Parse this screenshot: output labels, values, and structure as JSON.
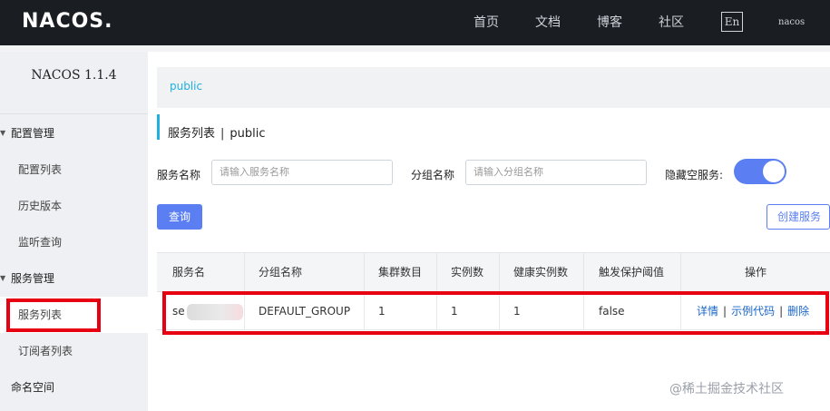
{
  "header": {
    "logo": "NACOS.",
    "nav": [
      "首页",
      "文档",
      "博客",
      "社区"
    ],
    "lang": "En",
    "user": "nacos"
  },
  "sidebar": {
    "version": "NACOS 1.1.4",
    "items": [
      {
        "label": "配置管理",
        "type": "group"
      },
      {
        "label": "配置列表",
        "type": "sub"
      },
      {
        "label": "历史版本",
        "type": "sub"
      },
      {
        "label": "监听查询",
        "type": "sub"
      },
      {
        "label": "服务管理",
        "type": "group"
      },
      {
        "label": "服务列表",
        "type": "sub"
      },
      {
        "label": "订阅者列表",
        "type": "sub"
      },
      {
        "label": "命名空间",
        "type": "group"
      }
    ]
  },
  "main": {
    "namespace": "public",
    "title": "服务列表",
    "title_sep": "|",
    "title_ns": "public",
    "filters": {
      "service_label": "服务名称",
      "service_placeholder": "请输入服务名称",
      "group_label": "分组名称",
      "group_placeholder": "请输入分组名称",
      "hide_empty_label": "隐藏空服务:"
    },
    "query_button": "查询",
    "create_button": "创建服务",
    "table": {
      "columns": [
        "服务名",
        "分组名称",
        "集群数目",
        "实例数",
        "健康实例数",
        "触发保护阈值",
        "操作"
      ],
      "rows": [
        {
          "service": "se",
          "group": "DEFAULT_GROUP",
          "clusters": "1",
          "instances": "1",
          "healthy": "1",
          "threshold": "false",
          "ops": [
            "详情",
            "示例代码",
            "删除"
          ],
          "op_sep": "|"
        }
      ]
    }
  },
  "watermark": "@稀土掘金技术社区",
  "colors": {
    "accent": "#5b7ff2",
    "highlight": "#e60012",
    "link": "#1a66c8",
    "namespace": "#1eb0e0"
  }
}
